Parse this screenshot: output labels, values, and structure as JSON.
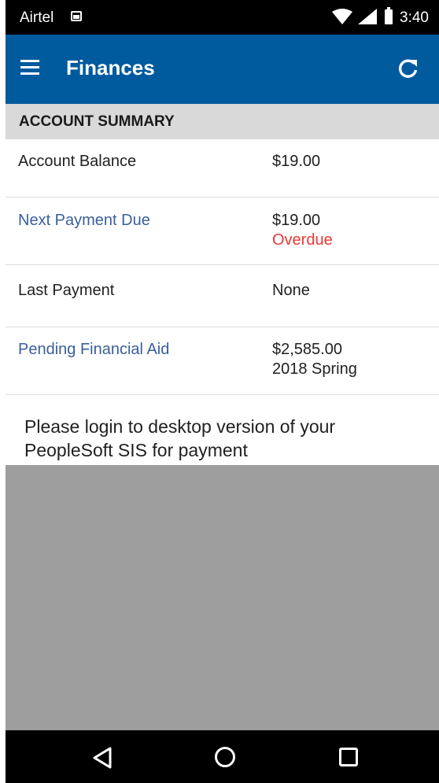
{
  "status_bar": {
    "carrier": "Airtel",
    "time": "3:40",
    "icons": [
      "image-notification-icon",
      "wifi-icon",
      "signal-icon",
      "battery-icon"
    ]
  },
  "app_bar": {
    "title": "Finances",
    "menu_icon": "menu-icon",
    "refresh_icon": "refresh-icon"
  },
  "account_summary": {
    "header": "ACCOUNT SUMMARY",
    "rows": [
      {
        "label": "Account Balance",
        "value": "$19.00"
      },
      {
        "label": "Next Payment Due",
        "value": "$19.00",
        "sub": "Overdue"
      },
      {
        "label": "Last Payment",
        "value": "None"
      },
      {
        "label": "Pending Financial Aid",
        "value": "$2,585.00",
        "sub": "2018 Spring"
      }
    ]
  },
  "notice": "Please login to desktop version of your PeopleSoft SIS for payment",
  "nav_bar": {
    "icons": [
      "back-icon",
      "home-icon",
      "recents-icon"
    ]
  },
  "colors": {
    "app_bar": "#005a9e",
    "link": "#3a5f9a",
    "overdue": "#e53935",
    "section_header_bg": "#d9d9d9",
    "empty_area": "#9e9e9e"
  }
}
